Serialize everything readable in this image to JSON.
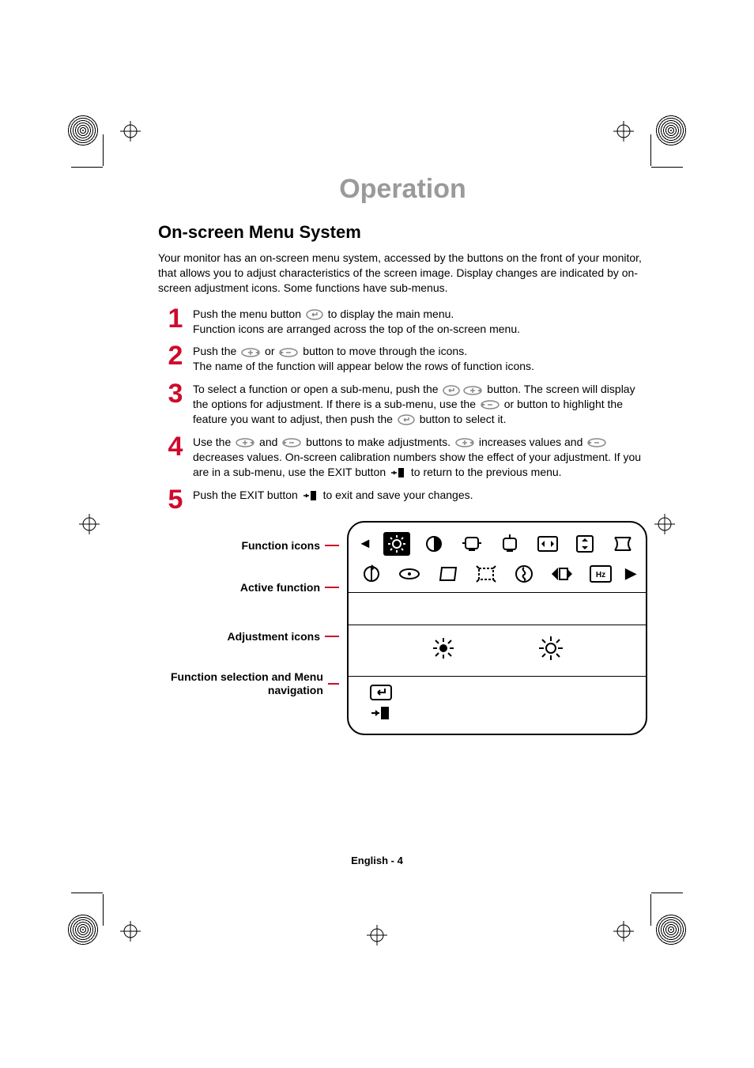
{
  "section_title": "Operation",
  "subhead": "On-screen Menu System",
  "intro": "Your monitor has an on-screen menu system, accessed by the buttons on the front of your monitor, that allows you to adjust characteristics of the screen image. Display changes are indicated by on-screen adjustment icons. Some functions have sub-menus.",
  "steps": [
    {
      "num": "1",
      "pre": "Push the menu button ",
      "icon": "enter",
      "post": " to display the main menu.",
      "line2": "Function icons are arranged across the top of the on-screen menu."
    },
    {
      "num": "2",
      "pre": "Push the ",
      "icon": "plus",
      "mid": " or ",
      "icon2": "minus",
      "post": " button to move through the icons.",
      "line2": "The name of the function will appear below the rows of function icons."
    },
    {
      "num": "3",
      "pre": "To select a function or open a sub-menu, push the ",
      "icon": "enter",
      "post": " button. The screen will display the options for adjustment. If there is a sub-menu, use the ",
      "icon2": "plus",
      "mid2": " or ",
      "icon3": "minus",
      "post2": " button to highlight the feature you want to adjust, then push the ",
      "icon4": "enter",
      "post3": " button to select it."
    },
    {
      "num": "4",
      "pre": "Use the ",
      "icon": "plus",
      "mid": " and ",
      "icon2": "minus",
      "post": " buttons to make adjustments. ",
      "icon3": "plus",
      "post2": " increases values and ",
      "icon4": "minus",
      "post3": " decreases values. On-screen calibration numbers show the effect of your adjustment. If you are in a sub-menu, use the EXIT button ",
      "icon5": "exit",
      "post4": " to return to the previous menu."
    },
    {
      "num": "5",
      "pre": "Push the EXIT button ",
      "icon": "exit",
      "post": " to exit and save your changes."
    }
  ],
  "diagram_labels": {
    "function_icons": "Function icons",
    "active_function": "Active function",
    "adjustment_icons": "Adjustment icons",
    "function_nav": "Function selection and Menu navigation"
  },
  "osd_row1": [
    "brightness",
    "contrast",
    "h-size",
    "v-size",
    "h-pos",
    "v-pos",
    "pincushion"
  ],
  "osd_row2": [
    "rotation",
    "tilt",
    "parallelogram",
    "zoom",
    "degauss",
    "moire",
    "hz"
  ],
  "footer": "English - 4"
}
